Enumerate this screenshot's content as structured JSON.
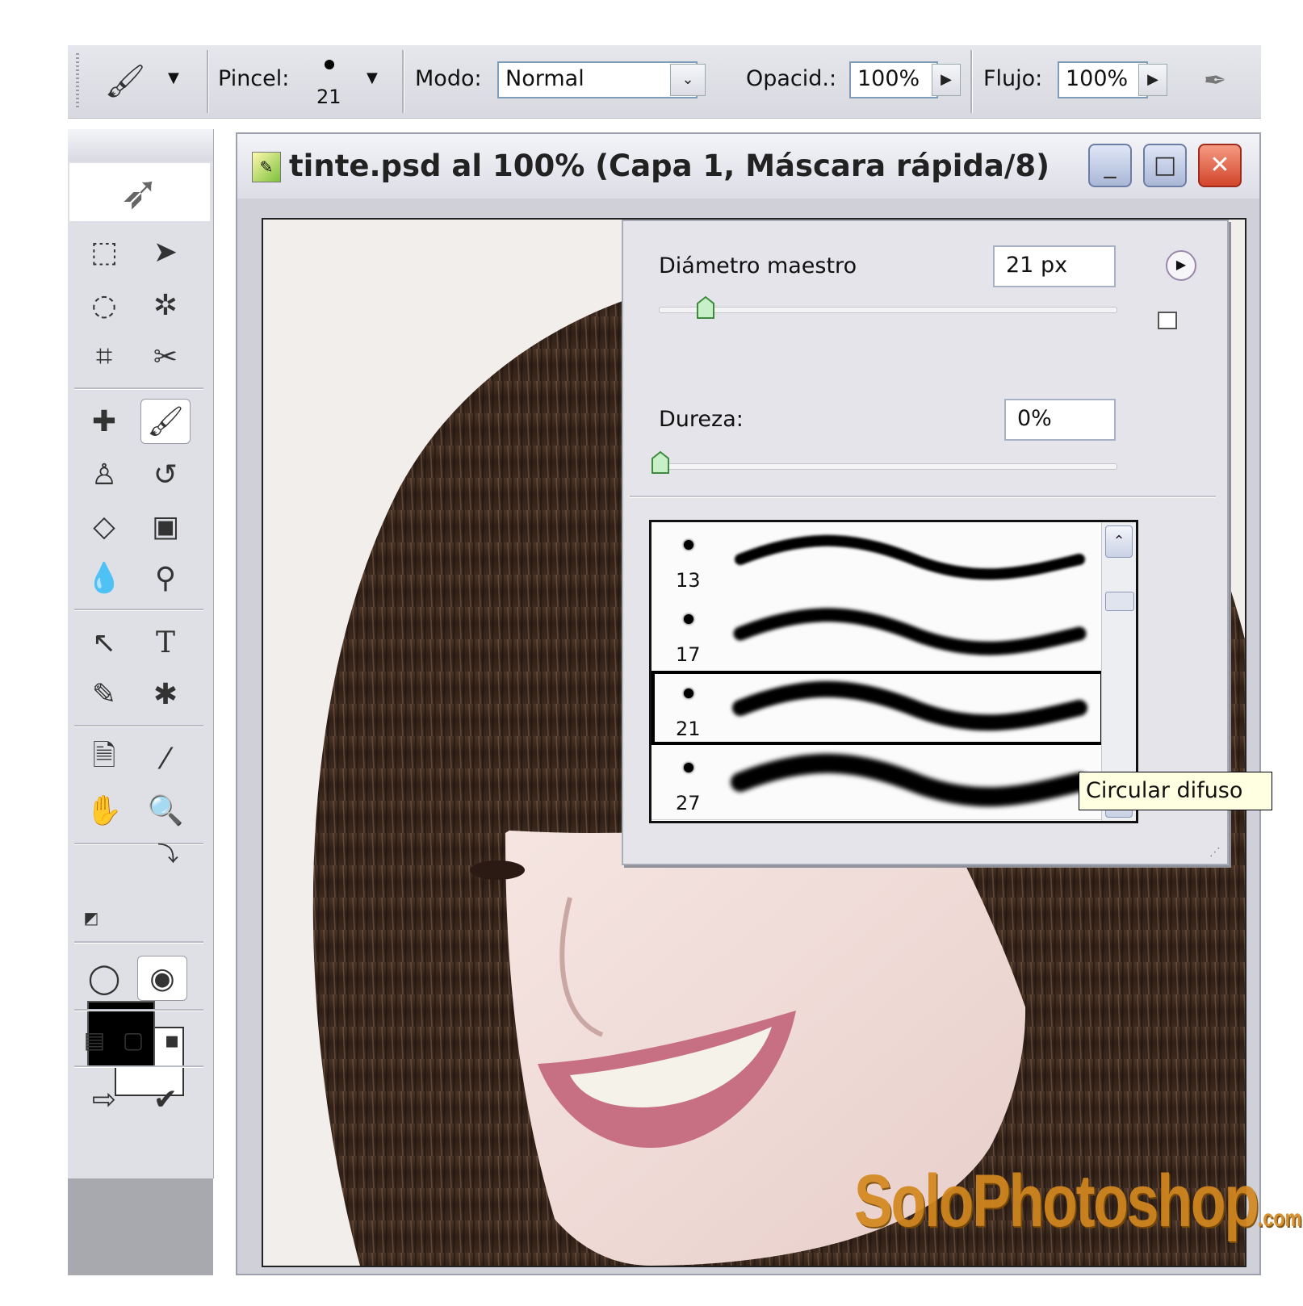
{
  "options_bar": {
    "brush_label": "Pincel:",
    "brush_size": "21",
    "mode_label": "Modo:",
    "mode_value": "Normal",
    "opacity_label": "Opacid.:",
    "opacity_value": "100%",
    "flow_label": "Flujo:",
    "flow_value": "100%",
    "icons": [
      "brush-tool-icon",
      "airbrush-icon"
    ]
  },
  "document": {
    "title": "tinte.psd al 100% (Capa 1, Máscara rápida/8)",
    "minimize": "_",
    "maximize": "□",
    "close": "✕"
  },
  "brush_panel": {
    "master_diameter_label": "Diámetro maestro",
    "master_diameter_value": "21 px",
    "master_diameter_level": 21,
    "hardness_label": "Dureza:",
    "hardness_value": "0%",
    "hardness_level": 0,
    "presets": [
      {
        "size": "13"
      },
      {
        "size": "17"
      },
      {
        "size": "21"
      },
      {
        "size": "27"
      }
    ],
    "selected_preset": "21",
    "tooltip": "Circular difuso"
  },
  "toolbox": {
    "tools": [
      "marquee-icon",
      "move-icon",
      "lasso-icon",
      "magic-wand-icon",
      "crop-icon",
      "slice-icon",
      "healing-brush-icon",
      "brush-icon",
      "clone-stamp-icon",
      "history-brush-icon",
      "eraser-icon",
      "gradient-icon",
      "blur-icon",
      "dodge-icon",
      "path-selection-icon",
      "type-icon",
      "pen-icon",
      "custom-shape-icon",
      "notes-icon",
      "eyedropper-icon",
      "hand-icon",
      "zoom-icon"
    ],
    "active_tool": "brush-icon",
    "foreground_color": "#000000",
    "background_color": "#ffffff"
  },
  "watermark": {
    "text": "SoloPhotoshop",
    "suffix": ".com"
  },
  "colors": {
    "accent": "#7f9db9",
    "close_button": "#d2452b",
    "tooltip_bg": "#ffffe1"
  }
}
